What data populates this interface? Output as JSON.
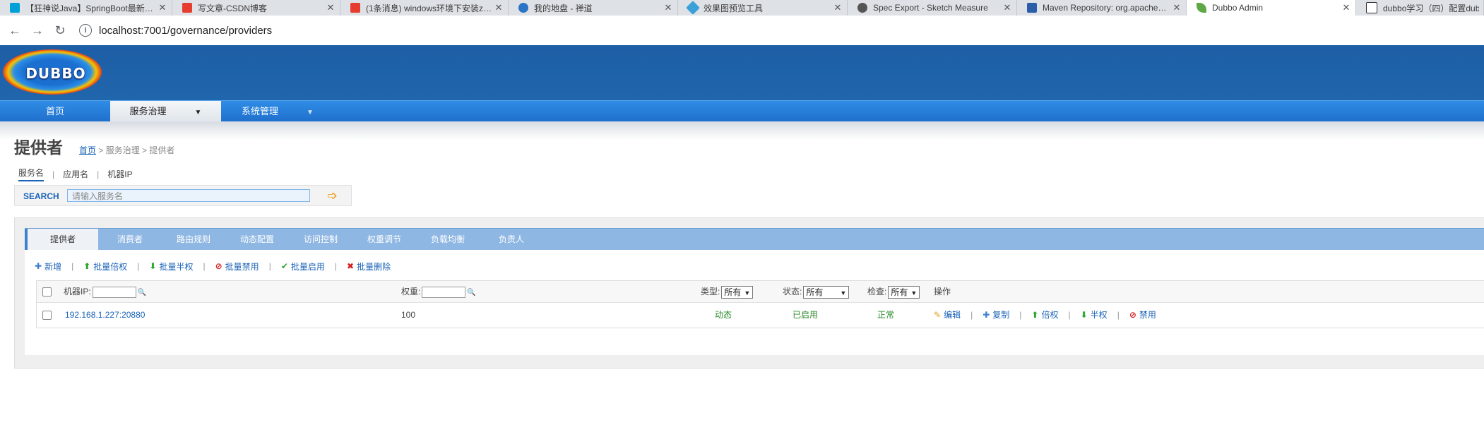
{
  "browser": {
    "tabs": [
      {
        "title": "【狂神说Java】SpringBoot最新…",
        "color": "#00a1d6"
      },
      {
        "title": "写文章-CSDN博客",
        "color": "#e53d2f"
      },
      {
        "title": "(1条消息) windows环境下安装z…",
        "color": "#e53d2f"
      },
      {
        "title": "我的地盘 - 禅道",
        "color": "#2b74c5"
      },
      {
        "title": "效果图预览工具",
        "color": "#3aa0d8"
      },
      {
        "title": "Spec Export - Sketch Measure",
        "color": "#555555"
      },
      {
        "title": "Maven Repository: org.apache…",
        "color": "#2b5ea8"
      },
      {
        "title": "Dubbo Admin",
        "color": "#5fa845"
      },
      {
        "title": "dubbo学习（四）配置dubbo…",
        "color": "#333333"
      }
    ],
    "url": "localhost:7001/governance/providers"
  },
  "logo_text": "DUBBO",
  "nav": {
    "home": "首页",
    "service_gov": "服务治理",
    "system": "系统管理"
  },
  "page": {
    "title": "提供者",
    "crumb_home": "首页",
    "crumb_rest": " > 服务治理 > 提供者",
    "subtabs": [
      "服务名",
      "应用名",
      "机器IP"
    ],
    "search_label": "SEARCH",
    "search_placeholder": "请输入服务名"
  },
  "panel_tabs": [
    "提供者",
    "消费者",
    "路由规则",
    "动态配置",
    "访问控制",
    "权重调节",
    "负载均衡",
    "负责人"
  ],
  "actions": [
    "新增",
    "批量倍权",
    "批量半权",
    "批量禁用",
    "批量启用",
    "批量删除"
  ],
  "table": {
    "headers": {
      "ip": "机器IP:",
      "weight": "权重:",
      "type": "类型:",
      "type_value": "所有",
      "status": "状态:",
      "status_value": "所有",
      "check": "检查:",
      "check_value": "所有",
      "ops": "操作"
    },
    "rows": [
      {
        "ip": "192.168.1.227:20880",
        "weight": "100",
        "type": "动态",
        "status": "已启用",
        "check": "正常",
        "ops": [
          "编辑",
          "复制",
          "倍权",
          "半权",
          "禁用"
        ]
      }
    ]
  }
}
